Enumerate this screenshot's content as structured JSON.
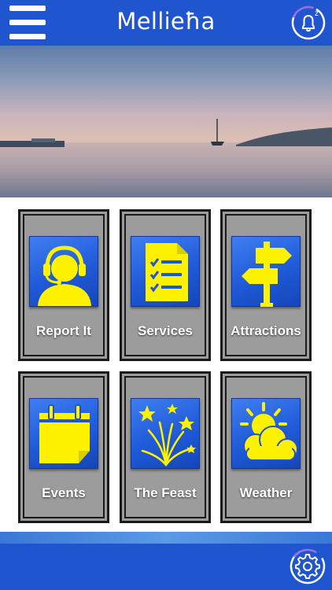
{
  "header": {
    "title": "Mellieħa",
    "menu_icon": "hamburger-menu-icon",
    "notification_icon": "bell-icon",
    "notification_badge": "z"
  },
  "hero": {
    "image": "sunset-bay-with-sailboat"
  },
  "tiles": [
    {
      "label": "Report It",
      "icon": "headset-support-icon"
    },
    {
      "label": "Services",
      "icon": "checklist-document-icon"
    },
    {
      "label": "Attractions",
      "icon": "signpost-icon"
    },
    {
      "label": "Events",
      "icon": "calendar-icon"
    },
    {
      "label": "The Feast",
      "icon": "fireworks-icon"
    },
    {
      "label": "Weather",
      "icon": "sun-cloud-icon"
    }
  ],
  "footer": {
    "settings_icon": "gear-icon"
  },
  "colors": {
    "primary": "#1f55cf",
    "tile_gray": "#9c9c9c",
    "icon_yellow": "#fff200",
    "icon_blue": "#2563e0"
  }
}
